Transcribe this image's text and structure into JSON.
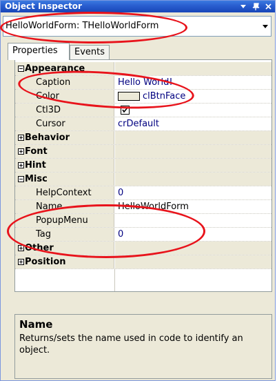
{
  "window": {
    "title": "Object Inspector",
    "icons": [
      "pin-icon",
      "close-icon"
    ]
  },
  "selector": {
    "value": "HelloWorldForm: THelloWorldForm"
  },
  "tabs": [
    {
      "label": "Properties",
      "active": true
    },
    {
      "label": "Events",
      "active": false
    }
  ],
  "grid": {
    "rows": [
      {
        "kind": "category",
        "expanded": true,
        "name": "Appearance",
        "value": ""
      },
      {
        "kind": "property",
        "name": "Caption",
        "value": "Hello World!"
      },
      {
        "kind": "property",
        "name": "Color",
        "value": "clBtnFace"
      },
      {
        "kind": "property",
        "name": "Ctl3D",
        "value": "",
        "checked": true
      },
      {
        "kind": "property",
        "name": "Cursor",
        "value": "crDefault"
      },
      {
        "kind": "category",
        "expanded": false,
        "name": "Behavior",
        "value": ""
      },
      {
        "kind": "category",
        "expanded": false,
        "name": "Font",
        "value": ""
      },
      {
        "kind": "category",
        "expanded": false,
        "name": "Hint",
        "value": ""
      },
      {
        "kind": "category",
        "expanded": true,
        "name": "Misc",
        "value": ""
      },
      {
        "kind": "property",
        "name": "HelpContext",
        "value": "0"
      },
      {
        "kind": "property",
        "name": "Name",
        "value": "HelloWorldForm",
        "selected": true
      },
      {
        "kind": "property",
        "name": "PopupMenu",
        "value": ""
      },
      {
        "kind": "property",
        "name": "Tag",
        "value": "0"
      },
      {
        "kind": "category",
        "expanded": false,
        "name": "Other",
        "value": ""
      },
      {
        "kind": "category",
        "expanded": false,
        "name": "Position",
        "value": ""
      }
    ]
  },
  "help": {
    "title": "Name",
    "description": "Returns/sets the name used in code to identify an object."
  },
  "colors": {
    "annotation": "#e8131b",
    "value_text": "#000080",
    "titlebar": "#2a5fd0"
  }
}
